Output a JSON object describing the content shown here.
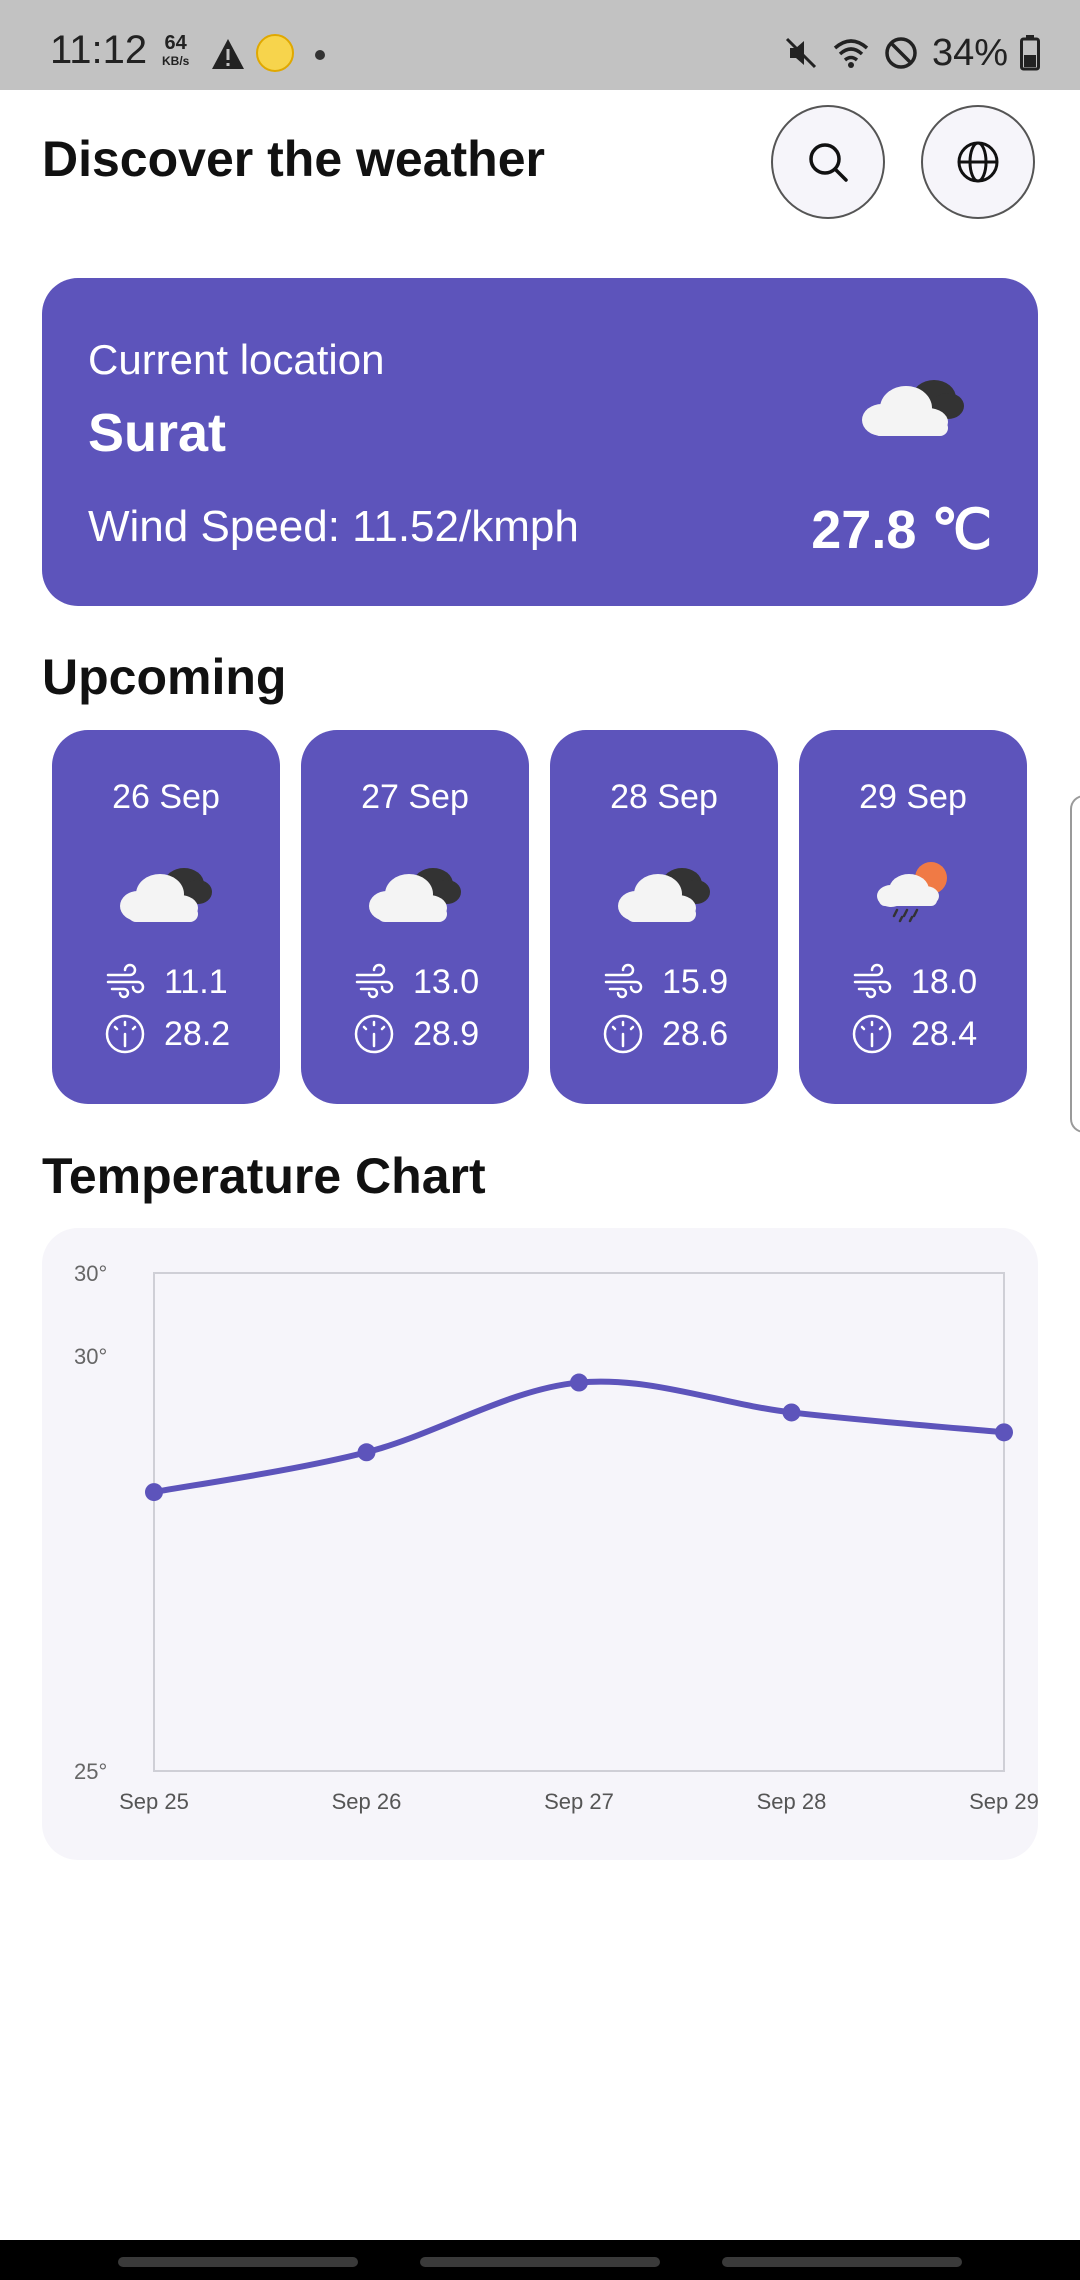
{
  "status_bar": {
    "time": "11:12",
    "net_speed_value": "64",
    "net_speed_unit": "KB/s",
    "battery": "34%"
  },
  "header": {
    "title": "Discover the weather",
    "search_icon": "search-icon",
    "globe_icon": "globe-icon"
  },
  "current": {
    "label": "Current location",
    "city": "Surat",
    "wind": "Wind Speed: 11.52/kmph",
    "temperature": "27.8 ℃",
    "icon": "cloud-icon"
  },
  "upcoming": {
    "title": "Upcoming",
    "days": [
      {
        "date": "26 Sep",
        "wind": "11.1",
        "temp": "28.2",
        "icon": "cloud-icon"
      },
      {
        "date": "27 Sep",
        "wind": "13.0",
        "temp": "28.9",
        "icon": "cloud-icon"
      },
      {
        "date": "28 Sep",
        "wind": "15.9",
        "temp": "28.6",
        "icon": "cloud-icon"
      },
      {
        "date": "29 Sep",
        "wind": "18.0",
        "temp": "28.4",
        "icon": "rain-sun-icon"
      }
    ]
  },
  "chart": {
    "title": "Temperature Chart"
  },
  "chart_data": {
    "type": "line",
    "categories": [
      "Sep 25",
      "Sep 26",
      "Sep 27",
      "Sep 28",
      "Sep 29"
    ],
    "values": [
      27.8,
      28.2,
      28.9,
      28.6,
      28.4
    ],
    "y_tick_labels": [
      "30°",
      "30°",
      "25°"
    ],
    "ylim": [
      25,
      30
    ],
    "grid": false,
    "color": "#5d54bb"
  },
  "colors": {
    "accent": "#5d54bb",
    "chart_background": "#f6f5fa"
  }
}
